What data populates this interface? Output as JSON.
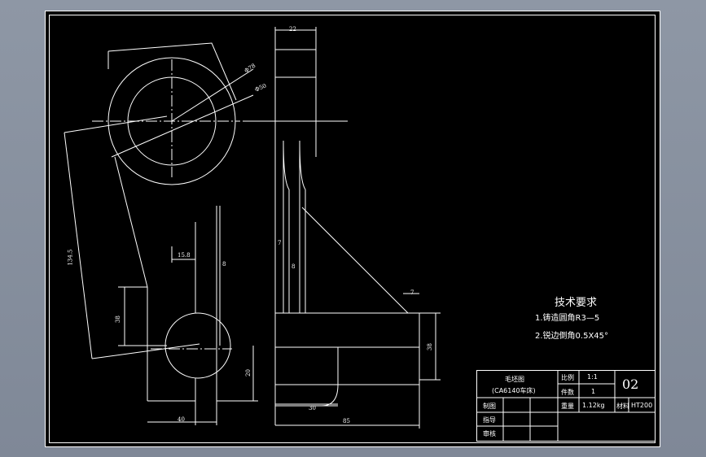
{
  "tech_requirements": {
    "title": "技术要求",
    "items": [
      "1.铸造圆角R3—5",
      "2.锐边倒角0.5X45°"
    ]
  },
  "title_block": {
    "drawing_name": "毛坯图",
    "machine": "(CA6140车床)",
    "scale_label": "比例",
    "scale_value": "1:1",
    "qty_label": "件数",
    "qty_value": "1",
    "drawing_no": "02",
    "weight_label": "重量",
    "weight_value": "1.12kg",
    "material_label": "材料",
    "material_value": "HT200",
    "drawn_label": "制图",
    "guide_label": "指导",
    "review_label": "审核"
  },
  "dimensions": {
    "top_width": "22",
    "dia_large": "Φ78",
    "dia_inner": "Φ50",
    "slant_length": "134.5",
    "offset_15_8": "15.8",
    "web_8_left": "8",
    "web_7": "7",
    "web_8_right": "8",
    "rib_7": "7",
    "boss_height": "38",
    "hub_height_right": "38",
    "bottom_20": "20",
    "bottom_40": "40",
    "bottom_30": "30",
    "bottom_85": "85"
  }
}
